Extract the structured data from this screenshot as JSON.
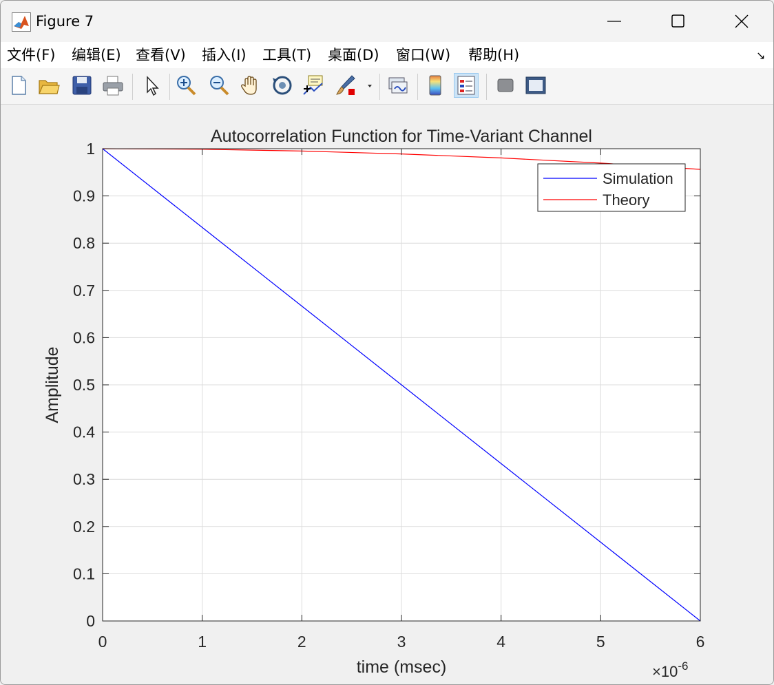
{
  "window": {
    "title": "Figure 7",
    "minimize_icon": "minimize-icon",
    "maximize_icon": "maximize-icon",
    "close_icon": "close-icon"
  },
  "menubar": {
    "items": [
      {
        "label": "文件(F)"
      },
      {
        "label": "编辑(E)"
      },
      {
        "label": "查看(V)"
      },
      {
        "label": "插入(I)"
      },
      {
        "label": "工具(T)"
      },
      {
        "label": "桌面(D)"
      },
      {
        "label": "窗口(W)"
      },
      {
        "label": "帮助(H)"
      }
    ]
  },
  "toolbar": {
    "buttons": [
      {
        "icon": "new-figure-icon"
      },
      {
        "icon": "open-file-icon"
      },
      {
        "icon": "save-icon"
      },
      {
        "icon": "print-icon"
      },
      {
        "icon": "select-pointer-icon"
      },
      {
        "icon": "zoom-in-icon"
      },
      {
        "icon": "zoom-out-icon"
      },
      {
        "icon": "pan-hand-icon"
      },
      {
        "icon": "rotate-3d-icon"
      },
      {
        "icon": "data-cursor-icon"
      },
      {
        "icon": "brush-icon"
      },
      {
        "icon": "link-plot-icon"
      },
      {
        "icon": "colorbar-icon"
      },
      {
        "icon": "legend-icon"
      },
      {
        "icon": "hide-plot-tools-icon"
      },
      {
        "icon": "show-plot-tools-icon"
      }
    ]
  },
  "chart_data": {
    "type": "line",
    "title": "Autocorrelation Function for Time-Variant Channel",
    "xlabel": "time (msec)",
    "ylabel": "Amplitude",
    "x_exponent_label": "×10",
    "x_exponent": "-6",
    "xlim": [
      0,
      6
    ],
    "ylim": [
      0,
      1
    ],
    "x_scale_multiplier": 1e-06,
    "xticks": [
      "0",
      "1",
      "2",
      "3",
      "4",
      "5",
      "6"
    ],
    "yticks": [
      "0",
      "0.1",
      "0.2",
      "0.3",
      "0.4",
      "0.5",
      "0.6",
      "0.7",
      "0.8",
      "0.9",
      "1"
    ],
    "grid": true,
    "legend_position": "top-right",
    "series": [
      {
        "name": "Simulation",
        "color": "#0000ff",
        "x": [
          0,
          1,
          2,
          3,
          4,
          5,
          6
        ],
        "y": [
          1,
          0.8333,
          0.6667,
          0.5,
          0.3333,
          0.1667,
          0
        ]
      },
      {
        "name": "Theory",
        "color": "#ff0000",
        "x": [
          0,
          1,
          2,
          3,
          4,
          5,
          6
        ],
        "y": [
          1,
          0.9988,
          0.9951,
          0.9889,
          0.9804,
          0.9696,
          0.9563
        ]
      }
    ]
  }
}
